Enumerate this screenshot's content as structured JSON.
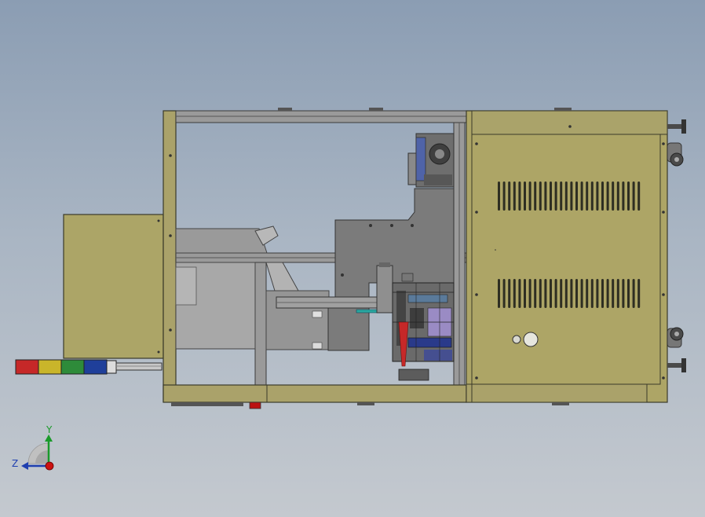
{
  "colors": {
    "frame": "#a9a06a",
    "panel": "#ada566",
    "frame_edge": "#3a3a2a",
    "mechanism_gray": "#7d7d7d",
    "mechanism_light": "#b0b0b0",
    "mechanism_dark": "#555555",
    "tower_red": "#c62828",
    "tower_yellow": "#c9b52a",
    "tower_green": "#2e8b3a",
    "tower_blue": "#1f3f9a",
    "axis_y": "#1a9a2a",
    "axis_z": "#1f3fb0",
    "origin": "#cc1111"
  },
  "view": {
    "description_icon": "triad-icon",
    "axes": {
      "y_label": "Y",
      "z_label": "Z"
    }
  },
  "machine": {
    "signal_tower_segments": [
      "red",
      "yellow",
      "green",
      "blue",
      "white"
    ],
    "vent_rows": 2,
    "vent_slots_per_row": 28
  }
}
